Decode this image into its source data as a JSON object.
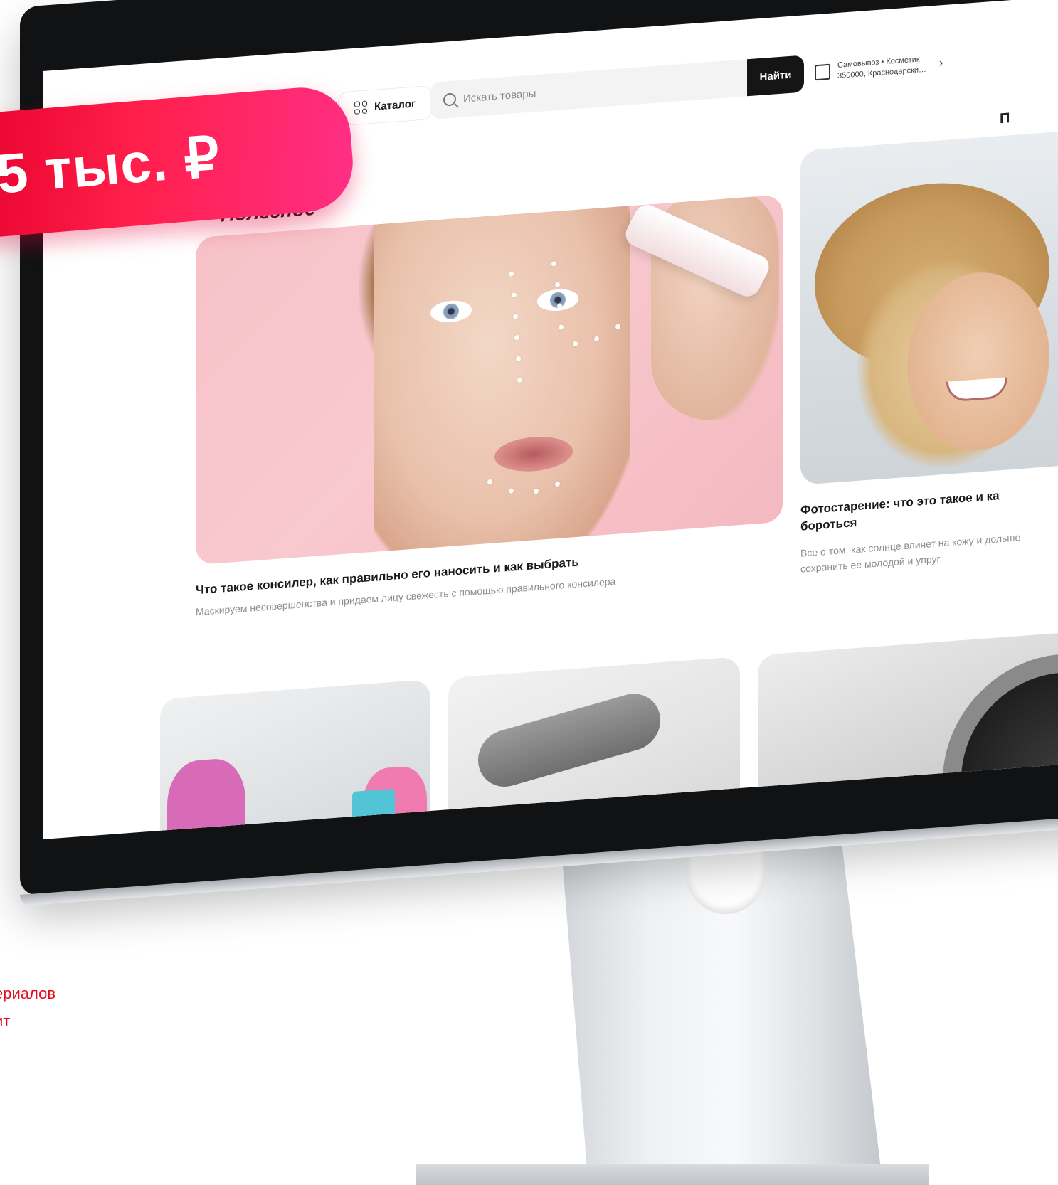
{
  "promo": {
    "price_text": "5 тыс. ₽"
  },
  "site": {
    "header": {
      "catalog_label": "Каталог",
      "search_placeholder": "Искать товары",
      "find_label": "Найти",
      "delivery_line1": "Самовывоз • Косметик",
      "delivery_line2": "350000, Краснодарски…",
      "right_cut_text": "П"
    },
    "section": {
      "title": "Полезное",
      "articles": [
        {
          "title": "Что такое консилер, как правильно его наносить и как выбрать",
          "description": "Маскируем несовершенства и придаем лицу свежесть с помощью правильного консилера"
        },
        {
          "title": "Фотостарение: что это такое и ка бороться",
          "description": "Все о том, как солнце влияет на кожу и дольше сохранить ее молодой и упруг"
        }
      ]
    }
  },
  "caption": {
    "line1": "ериалов",
    "line2": "ит"
  },
  "colors": {
    "accent": "#e4002b",
    "accent_pink": "#ff2f86",
    "button_dark": "#151515",
    "caption_red": "#e10b1b"
  }
}
